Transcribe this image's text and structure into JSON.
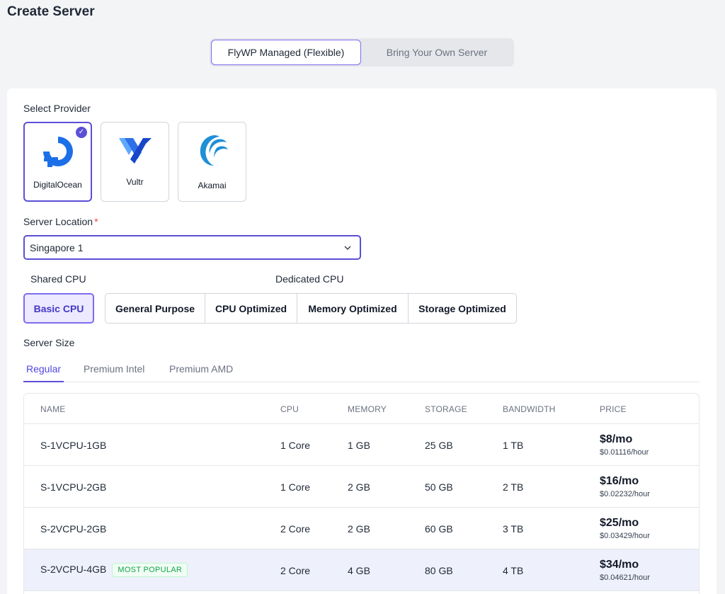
{
  "page": {
    "title": "Create Server"
  },
  "mode": {
    "options": [
      "FlyWP Managed (Flexible)",
      "Bring Your Own Server"
    ],
    "selected": 0
  },
  "provider": {
    "label": "Select Provider",
    "items": [
      {
        "name": "DigitalOcean",
        "icon": "digitalocean-logo-icon",
        "selected": true
      },
      {
        "name": "Vultr",
        "icon": "vultr-logo-icon",
        "selected": false
      },
      {
        "name": "Akamai",
        "icon": "akamai-logo-icon",
        "selected": false
      }
    ]
  },
  "location": {
    "label": "Server Location",
    "required_mark": "*",
    "value": "Singapore 1"
  },
  "cpu": {
    "shared_label": "Shared CPU",
    "dedicated_label": "Dedicated CPU",
    "shared_option": "Basic CPU",
    "dedicated_options": [
      "General Purpose",
      "CPU Optimized",
      "Memory Optimized",
      "Storage Optimized"
    ]
  },
  "size": {
    "label": "Server Size",
    "tabs": [
      "Regular",
      "Premium Intel",
      "Premium AMD"
    ],
    "active_tab": 0
  },
  "table": {
    "headers": {
      "name": "NAME",
      "cpu": "CPU",
      "memory": "MEMORY",
      "storage": "STORAGE",
      "bandwidth": "BANDWIDTH",
      "price": "PRICE"
    },
    "rows": [
      {
        "name": "S-1VCPU-1GB",
        "cpu": "1 Core",
        "memory": "1 GB",
        "storage": "25 GB",
        "bandwidth": "1 TB",
        "price": "$8/mo",
        "hourly": "$0.01116/hour"
      },
      {
        "name": "S-1VCPU-2GB",
        "cpu": "1 Core",
        "memory": "2 GB",
        "storage": "50 GB",
        "bandwidth": "2 TB",
        "price": "$16/mo",
        "hourly": "$0.02232/hour"
      },
      {
        "name": "S-2VCPU-2GB",
        "cpu": "2 Core",
        "memory": "2 GB",
        "storage": "60 GB",
        "bandwidth": "3 TB",
        "price": "$25/mo",
        "hourly": "$0.03429/hour"
      },
      {
        "name": "S-2VCPU-4GB",
        "badge": "MOST POPULAR",
        "cpu": "2 Core",
        "memory": "4 GB",
        "storage": "80 GB",
        "bandwidth": "4 TB",
        "price": "$34/mo",
        "hourly": "$0.04621/hour"
      }
    ]
  },
  "colors": {
    "accent": "#5b4fd6",
    "popular_row": "#eef0fb",
    "badge_green": "#16a34a"
  }
}
